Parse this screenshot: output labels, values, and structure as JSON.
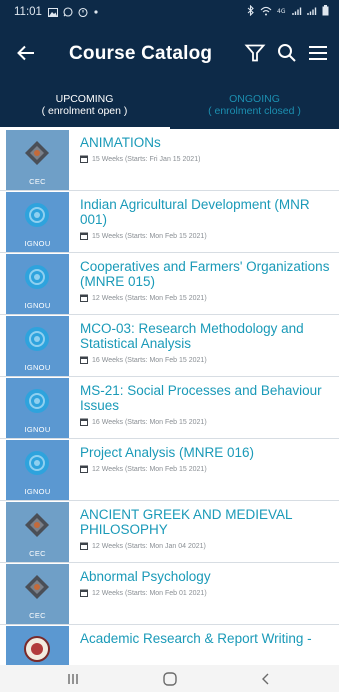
{
  "status": {
    "time": "11:01",
    "left_icons": [
      "gallery-icon",
      "whatsapp-icon",
      "timer-icon",
      "dot-icon"
    ],
    "right_icons": [
      "bluetooth-icon",
      "wifi-icon",
      "4g-icon",
      "signal-icon",
      "signal-icon",
      "battery-icon"
    ]
  },
  "appbar": {
    "title": "Course Catalog",
    "icons": [
      "back-arrow-icon",
      "filter-icon",
      "search-icon",
      "menu-icon"
    ]
  },
  "tabs": [
    {
      "line1": "UPCOMING",
      "line2": "( enrolment open )",
      "active": true
    },
    {
      "line1": "ONGOING",
      "line2": "( enrolment closed )",
      "active": false
    }
  ],
  "courses": [
    {
      "provider": "CEC",
      "title": "ANIMATIONs",
      "meta": "15 Weeks (Starts: Fri Jan 15 2021)"
    },
    {
      "provider": "IGNOU",
      "title": "Indian Agricultural Development (MNR 001)",
      "meta": "15 Weeks (Starts: Mon Feb 15 2021)"
    },
    {
      "provider": "IGNOU",
      "title": "Cooperatives and Farmers' Organizations (MNRE 015)",
      "meta": "12 Weeks (Starts: Mon Feb 15 2021)"
    },
    {
      "provider": "IGNOU",
      "title": "MCO-03: Research Methodology and Statistical Analysis",
      "meta": "16 Weeks (Starts: Mon Feb 15 2021)"
    },
    {
      "provider": "IGNOU",
      "title": "MS-21: Social Processes and Behaviour Issues",
      "meta": "16 Weeks (Starts: Mon Feb 15 2021)"
    },
    {
      "provider": "IGNOU",
      "title": "Project Analysis (MNRE 016)",
      "meta": "12 Weeks (Starts: Mon Feb 15 2021)"
    },
    {
      "provider": "CEC",
      "title": "ANCIENT GREEK AND MEDIEVAL PHILOSOPHY",
      "meta": "12 Weeks (Starts: Mon Jan 04 2021)"
    },
    {
      "provider": "CEC",
      "title": "Abnormal Psychology",
      "meta": "12 Weeks (Starts: Mon Feb 01 2021)"
    },
    {
      "provider": "",
      "title": "Academic Research & Report Writing -",
      "meta": ""
    }
  ],
  "colors": {
    "header_bg": "#0d2a48",
    "accent_teal": "#1a9ab8",
    "tab_inactive": "#1c8fb0",
    "cec_tile": "#6f9fc7",
    "ignou_tile": "#5b98d1"
  },
  "navbar": {
    "icons": [
      "recents-icon",
      "home-icon",
      "back-icon"
    ]
  }
}
